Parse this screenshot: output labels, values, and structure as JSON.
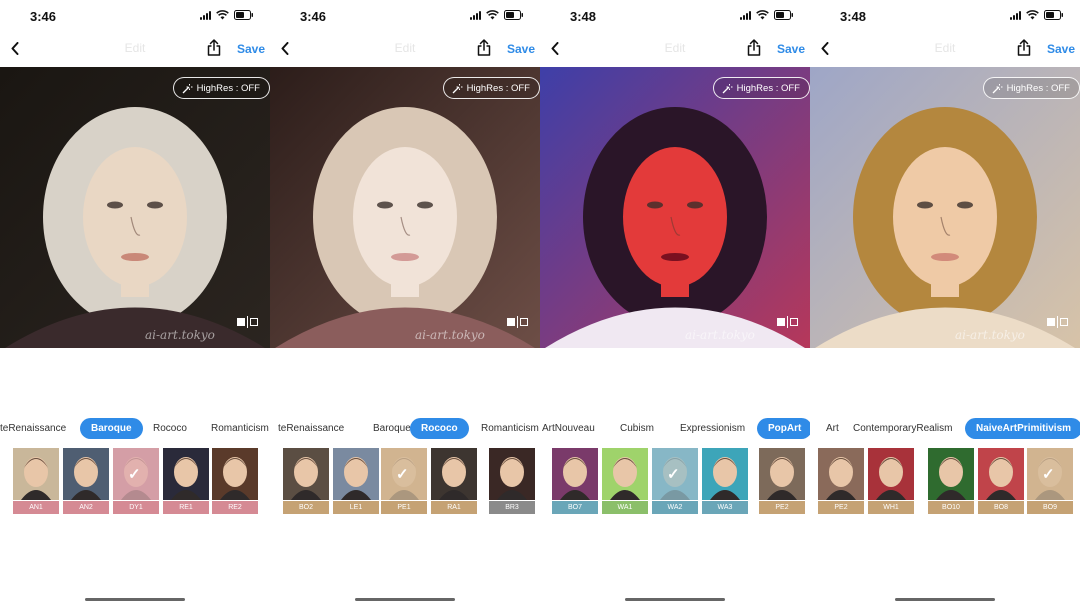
{
  "colors": {
    "accent": "#2f8be7",
    "label_pink": "#d58a94",
    "label_tan": "#c5a274",
    "label_gray": "#8a8a8a",
    "label_teal": "#6aa6b8",
    "label_green": "#8bbf6a"
  },
  "screens": [
    {
      "time": "3:46",
      "nav": {
        "title": "Edit",
        "save": "Save",
        "back_icon": "chevron-left-icon",
        "share_icon": "share-icon"
      },
      "highres": "HighRes : OFF",
      "watermark": "ai-art.tokyo",
      "categories": [
        "teRenaissance",
        "Baroque",
        "Rococo",
        "Romanticism"
      ],
      "active_category": "Baroque",
      "thumbs": [
        {
          "label": "AN1",
          "color": "pink",
          "selected": false
        },
        {
          "label": "AN2",
          "color": "pink",
          "selected": false
        },
        {
          "label": "DY1",
          "color": "pink",
          "selected": true
        },
        {
          "label": "RE1",
          "color": "pink",
          "selected": false
        },
        {
          "label": "RE2",
          "color": "pink",
          "selected": false
        }
      ]
    },
    {
      "time": "3:46",
      "nav": {
        "title": "Edit",
        "save": "Save",
        "back_icon": "chevron-left-icon",
        "share_icon": "share-icon"
      },
      "highres": "HighRes : OFF",
      "watermark": "ai-art.tokyo",
      "categories": [
        "teRenaissance",
        "Baroque",
        "Rococo",
        "Romanticism"
      ],
      "active_category": "Rococo",
      "thumbs": [
        {
          "label": "BO2",
          "color": "tan",
          "selected": false
        },
        {
          "label": "LE1",
          "color": "tan",
          "selected": false
        },
        {
          "label": "PE1",
          "color": "tan",
          "selected": true
        },
        {
          "label": "RA1",
          "color": "tan",
          "selected": false
        },
        {
          "label": "BR3",
          "color": "gray",
          "selected": false
        }
      ]
    },
    {
      "time": "3:48",
      "nav": {
        "title": "Edit",
        "save": "Save",
        "back_icon": "chevron-left-icon",
        "share_icon": "share-icon"
      },
      "highres": "HighRes : OFF",
      "watermark": "ai-art.tokyo",
      "categories": [
        "ArtNouveau",
        "Cubism",
        "Expressionism",
        "PopArt"
      ],
      "active_category": "PopArt",
      "thumbs": [
        {
          "label": "BO7",
          "color": "teal",
          "selected": false
        },
        {
          "label": "WA1",
          "color": "green",
          "selected": false
        },
        {
          "label": "WA2",
          "color": "teal",
          "selected": true
        },
        {
          "label": "WA3",
          "color": "teal",
          "selected": false
        },
        {
          "label": "PE2",
          "color": "tan",
          "selected": false
        }
      ]
    },
    {
      "time": "3:48",
      "nav": {
        "title": "Edit",
        "save": "Save",
        "back_icon": "chevron-left-icon",
        "share_icon": "share-icon"
      },
      "highres": "HighRes : OFF",
      "watermark": "ai-art.tokyo",
      "categories": [
        "Art",
        "ContemporaryRealism",
        "NaiveArtPrimitivism"
      ],
      "active_category": "NaiveArtPrimitivism",
      "thumbs": [
        {
          "label": "PE2",
          "color": "tan",
          "selected": false
        },
        {
          "label": "WH1",
          "color": "tan",
          "selected": false
        },
        {
          "label": "BO10",
          "color": "tan",
          "selected": false
        },
        {
          "label": "BO8",
          "color": "tan",
          "selected": false
        },
        {
          "label": "BO9",
          "color": "tan",
          "selected": true
        }
      ]
    }
  ]
}
